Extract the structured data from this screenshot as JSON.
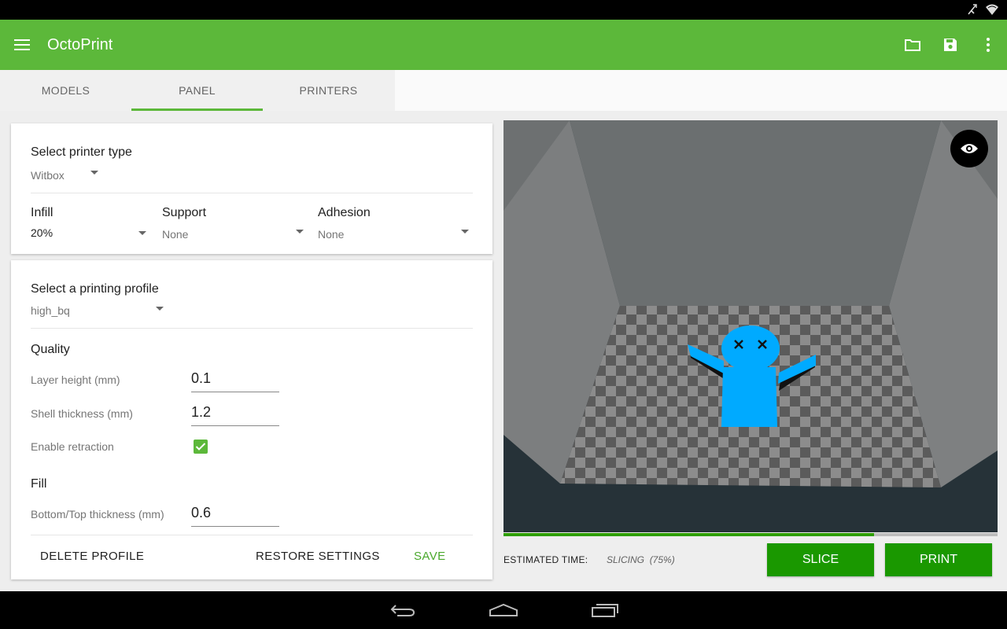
{
  "app": {
    "title": "OctoPrint"
  },
  "colors": {
    "accent": "#5cb83a",
    "button": "#1a9800",
    "model": "#00aaff"
  },
  "icons": {
    "menu": "hamburger-menu-icon",
    "folder": "folder-icon",
    "save": "save-icon",
    "overflow": "more-vert-icon",
    "eye": "eye-icon",
    "back": "back-icon",
    "home": "home-icon",
    "recents": "recent-apps-icon"
  },
  "tabs": [
    {
      "label": "MODELS",
      "active": false
    },
    {
      "label": "PANEL",
      "active": true
    },
    {
      "label": "PRINTERS",
      "active": false
    }
  ],
  "printer_card": {
    "title": "Select printer type",
    "printer_value": "Witbox",
    "infill_label": "Infill",
    "infill_value": "20%",
    "support_label": "Support",
    "support_value": "None",
    "adhesion_label": "Adhesion",
    "adhesion_value": "None"
  },
  "profile_card": {
    "title": "Select a printing profile",
    "profile_value": "high_bq",
    "quality_heading": "Quality",
    "layer_height_label": "Layer height (mm)",
    "layer_height_value": "0.1",
    "shell_thickness_label": "Shell thickness (mm)",
    "shell_thickness_value": "1.2",
    "retraction_label": "Enable retraction",
    "retraction_checked": true,
    "fill_heading": "Fill",
    "bottom_top_label": "Bottom/Top thickness (mm)",
    "bottom_top_value": "0.6",
    "delete_label": "DELETE PROFILE",
    "restore_label": "RESTORE SETTINGS",
    "save_label": "SAVE"
  },
  "slicing": {
    "estimated_label": "ESTIMATED TIME:",
    "status_text": "SLICING",
    "progress_text": "(75%)",
    "progress_fraction": 0.75,
    "slice_label": "SLICE",
    "print_label": "PRINT"
  }
}
